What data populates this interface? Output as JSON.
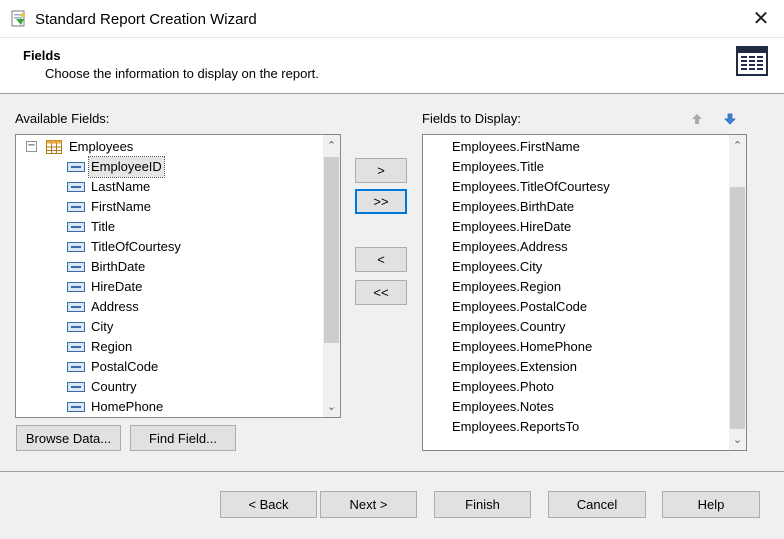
{
  "window": {
    "title": "Standard Report Creation Wizard",
    "close_glyph": "✕"
  },
  "header": {
    "title": "Fields",
    "subtitle": "Choose the information to display on the report.",
    "icon": "report-table-icon"
  },
  "available": {
    "label": "Available Fields:",
    "table_name": "Employees",
    "selected": "EmployeeID",
    "fields": [
      "EmployeeID",
      "LastName",
      "FirstName",
      "Title",
      "TitleOfCourtesy",
      "BirthDate",
      "HireDate",
      "Address",
      "City",
      "Region",
      "PostalCode",
      "Country",
      "HomePhone"
    ],
    "browse_label": "Browse Data...",
    "find_label": "Find Field..."
  },
  "move_buttons": {
    "add_one": ">",
    "add_all": ">>",
    "remove_one": "<",
    "remove_all": "<<"
  },
  "display": {
    "label": "Fields to Display:",
    "fields": [
      "Employees.FirstName",
      "Employees.Title",
      "Employees.TitleOfCourtesy",
      "Employees.BirthDate",
      "Employees.HireDate",
      "Employees.Address",
      "Employees.City",
      "Employees.Region",
      "Employees.PostalCode",
      "Employees.Country",
      "Employees.HomePhone",
      "Employees.Extension",
      "Employees.Photo",
      "Employees.Notes",
      "Employees.ReportsTo"
    ]
  },
  "footer": {
    "back": "< Back",
    "next": "Next >",
    "finish": "Finish",
    "cancel": "Cancel",
    "help": "Help"
  },
  "icons": {
    "scroll_up": "⌃",
    "scroll_down": "⌄",
    "collapse": "−"
  }
}
